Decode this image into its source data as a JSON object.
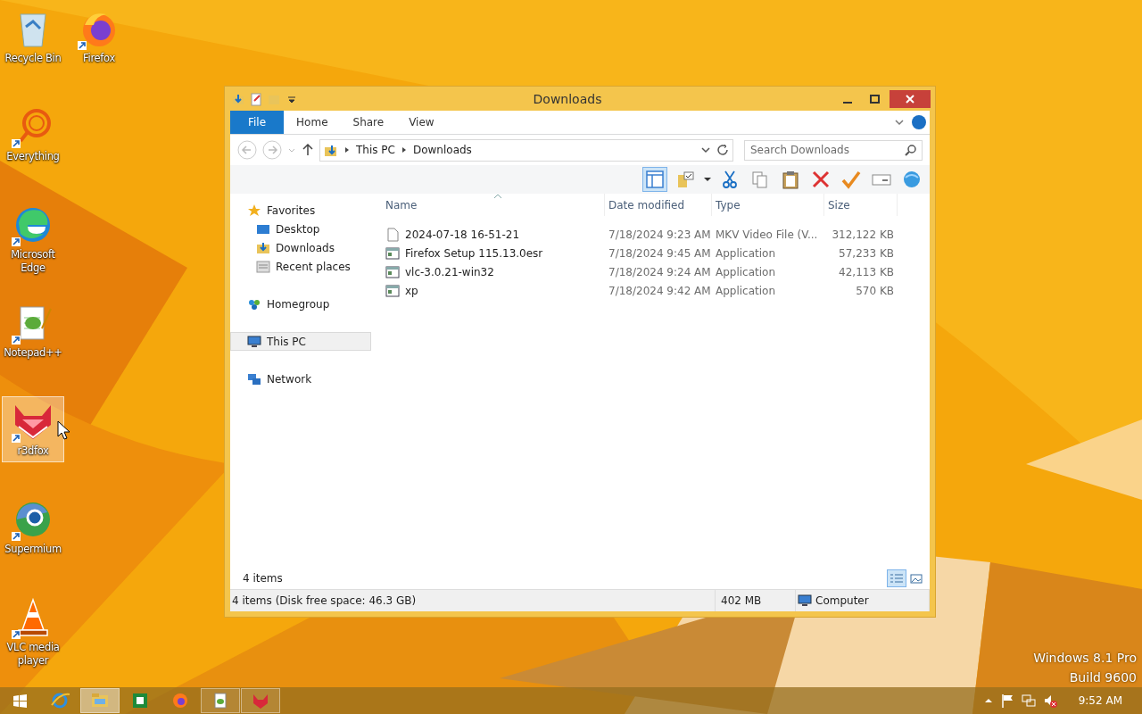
{
  "desktop_icons": [
    {
      "label": "Recycle Bin",
      "kind": "bin",
      "selected": false
    },
    {
      "label": "Firefox",
      "kind": "firefox",
      "selected": false
    },
    {
      "label": "Everything",
      "kind": "everything",
      "selected": false
    },
    {
      "label": "Microsoft Edge",
      "kind": "edge",
      "selected": false
    },
    {
      "label": "Notepad++",
      "kind": "notepad",
      "selected": false
    },
    {
      "label": "r3dfox",
      "kind": "r3dfox",
      "selected": true
    },
    {
      "label": "Supermium",
      "kind": "supermium",
      "selected": false
    },
    {
      "label": "VLC media player",
      "kind": "vlc",
      "selected": false
    }
  ],
  "window": {
    "title": "Downloads",
    "ribbon_tabs": [
      {
        "label": "File",
        "kind": "file",
        "selected": false
      },
      {
        "label": "Home",
        "kind": "tab",
        "selected": false
      },
      {
        "label": "Share",
        "kind": "tab",
        "selected": false
      },
      {
        "label": "View",
        "kind": "tab",
        "selected": false
      }
    ],
    "address_path": [
      "This PC",
      "Downloads"
    ],
    "search": {
      "placeholder": "Search Downloads"
    },
    "navigation": [
      {
        "label": "Favorites",
        "kind": "star",
        "selected": false,
        "children": [
          {
            "label": "Desktop",
            "kind": "desktop",
            "selected": false
          },
          {
            "label": "Downloads",
            "kind": "downloads",
            "selected": false
          },
          {
            "label": "Recent places",
            "kind": "recent",
            "selected": false
          }
        ]
      },
      {
        "label": "Homegroup",
        "kind": "homegroup",
        "selected": false
      },
      {
        "label": "This PC",
        "kind": "pc",
        "selected": true
      },
      {
        "label": "Network",
        "kind": "network",
        "selected": false
      }
    ],
    "columns": [
      {
        "label": "Name",
        "sorted": true
      },
      {
        "label": "Date modified",
        "sorted": false
      },
      {
        "label": "Type",
        "sorted": false
      },
      {
        "label": "Size",
        "sorted": false
      }
    ],
    "rows": [
      {
        "name": "2024-07-18 16-51-21",
        "kind": "file",
        "date": "7/18/2024 9:23 AM",
        "type": "MKV Video File (V...",
        "size": "312,122 KB"
      },
      {
        "name": "Firefox Setup 115.13.0esr",
        "kind": "app",
        "date": "7/18/2024 9:45 AM",
        "type": "Application",
        "size": "57,233 KB"
      },
      {
        "name": "vlc-3.0.21-win32",
        "kind": "app",
        "date": "7/18/2024 9:24 AM",
        "type": "Application",
        "size": "42,113 KB"
      },
      {
        "name": "xp",
        "kind": "app",
        "date": "7/18/2024 9:42 AM",
        "type": "Application",
        "size": "570 KB"
      }
    ],
    "item_count": "4 items",
    "views": [
      {
        "kind": "details",
        "selected": true
      },
      {
        "kind": "tiles",
        "selected": false
      }
    ],
    "status_bar": [
      "4 items (Disk free space: 46.3 GB)",
      "402 MB",
      "Computer"
    ]
  },
  "edition": [
    "Windows 8.1 Pro",
    "Build 9600"
  ],
  "taskbar": {
    "items": [
      {
        "kind": "ie",
        "selected": false,
        "running": false
      },
      {
        "kind": "explorer",
        "selected": true,
        "running": true
      },
      {
        "kind": "sheet",
        "selected": false,
        "running": false
      },
      {
        "kind": "firefox",
        "selected": false,
        "running": false
      },
      {
        "kind": "notepad",
        "selected": false,
        "running": true
      },
      {
        "kind": "r3dfox",
        "selected": false,
        "running": true
      }
    ],
    "clock": "9:52 AM"
  }
}
